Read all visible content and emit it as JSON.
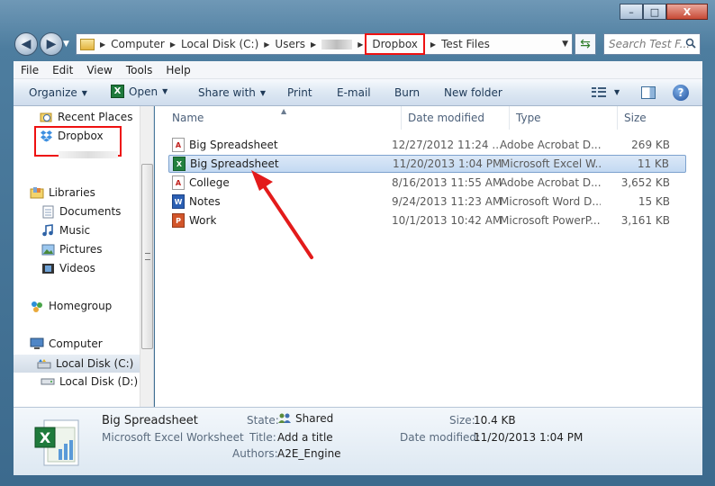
{
  "window": {
    "minimize": "–",
    "maximize": "□",
    "close": "X"
  },
  "address": {
    "crumbs": [
      "Computer",
      "Local Disk (C:)",
      "Users",
      "Dropbox",
      "Test Files"
    ],
    "highlighted": "Dropbox"
  },
  "search": {
    "placeholder": "Search Test F..."
  },
  "menubar": [
    "File",
    "Edit",
    "View",
    "Tools",
    "Help"
  ],
  "commands": {
    "organize": "Organize",
    "open": "Open",
    "share_with": "Share with",
    "print": "Print",
    "email": "E-mail",
    "burn": "Burn",
    "new_folder": "New folder"
  },
  "nav": {
    "recent_places": "Recent Places",
    "dropbox": "Dropbox",
    "libraries": "Libraries",
    "documents": "Documents",
    "music": "Music",
    "pictures": "Pictures",
    "videos": "Videos",
    "homegroup": "Homegroup",
    "computer": "Computer",
    "local_c": "Local Disk (C:)",
    "local_d": "Local Disk (D:)"
  },
  "columns": {
    "name": "Name",
    "date_modified": "Date modified",
    "type": "Type",
    "size": "Size"
  },
  "files": [
    {
      "name": "Big Spreadsheet",
      "date": "12/27/2012 11:24 ...",
      "type": "Adobe Acrobat D...",
      "size": "269 KB",
      "icon": "pdf-icon",
      "selected": false
    },
    {
      "name": "Big Spreadsheet",
      "date": "11/20/2013 1:04 PM",
      "type": "Microsoft Excel W...",
      "size": "11 KB",
      "icon": "excel-icon",
      "selected": true
    },
    {
      "name": "College",
      "date": "8/16/2013 11:55 AM",
      "type": "Adobe Acrobat D...",
      "size": "3,652 KB",
      "icon": "pdf-icon",
      "selected": false
    },
    {
      "name": "Notes",
      "date": "9/24/2013 11:23 AM",
      "type": "Microsoft Word D...",
      "size": "15 KB",
      "icon": "word-icon",
      "selected": false
    },
    {
      "name": "Work",
      "date": "10/1/2013 10:42 AM",
      "type": "Microsoft PowerP...",
      "size": "3,161 KB",
      "icon": "powerpoint-icon",
      "selected": false
    }
  ],
  "details": {
    "name": "Big Spreadsheet",
    "kind": "Microsoft Excel Worksheet",
    "state_label": "State:",
    "state_value": "Shared",
    "title_label": "Title:",
    "title_value": "Add a title",
    "authors_label": "Authors:",
    "authors_value": "A2E_Engine",
    "size_label": "Size:",
    "size_value": "10.4 KB",
    "date_label": "Date modified:",
    "date_value": "11/20/2013 1:04 PM"
  },
  "colors": {
    "highlight_box": "#ee1111",
    "annotation_arrow": "#e31b1b",
    "selection": "#c3d9f2"
  }
}
